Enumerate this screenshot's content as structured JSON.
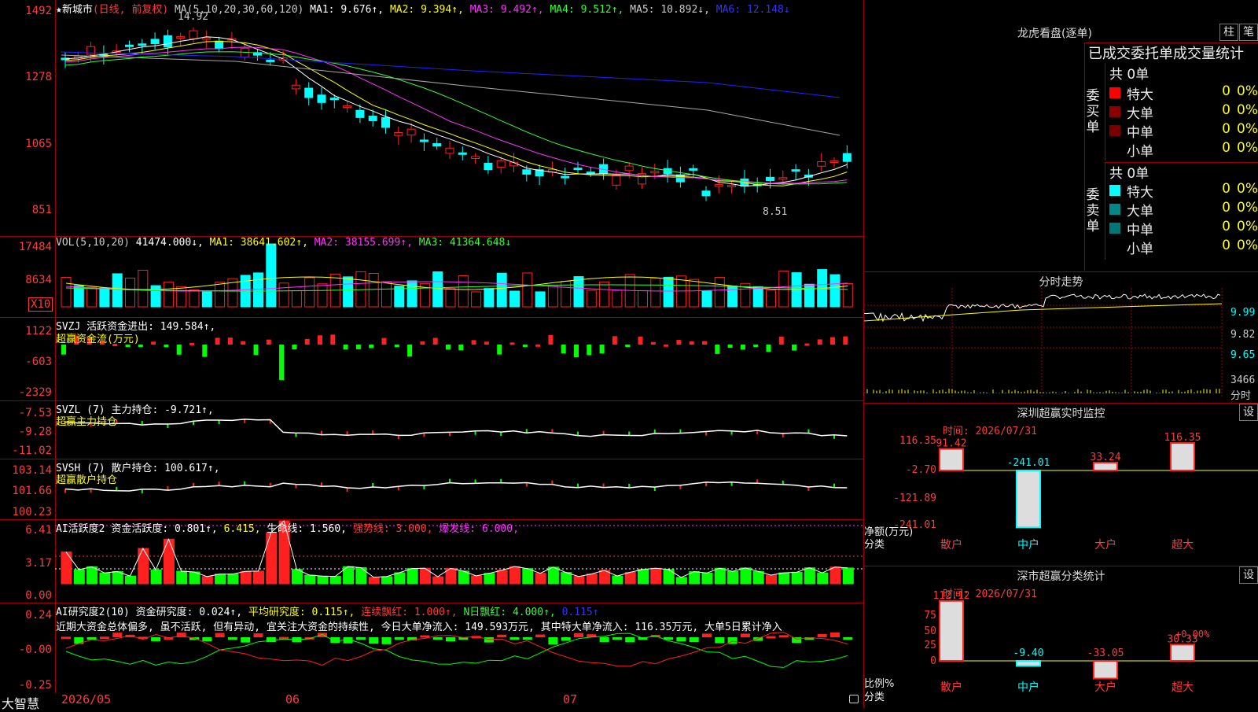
{
  "colors": {
    "up": "#ff2020",
    "down": "#00ffff",
    "grid": "#a00000",
    "axis": "#ff3b3b",
    "ma1": "#ffffff",
    "ma2": "#ffff00",
    "ma3": "#ff33ff",
    "ma4": "#33ff33",
    "ma5": "#aaaaaa",
    "ma6": "#2222ff"
  },
  "kline": {
    "star": "★",
    "stock_name": "新城市",
    "period": "(日线, 前复权)",
    "ma_params": "MA(5,10,20,30,60,120)",
    "ma1": "MA1: 9.676↑,",
    "ma2": "MA2: 9.394↑,",
    "ma3": "MA3: 9.492↑,",
    "ma4": "MA4: 9.512↑,",
    "ma5": "MA5: 10.892↓,",
    "ma6": "MA6: 12.148↓",
    "y_labels": [
      "1492",
      "1278",
      "1065",
      "851"
    ],
    "high_mark": "14.92",
    "low_mark": "8.51"
  },
  "vol": {
    "params": "VOL(5,10,20)",
    "val": "41474.000↓,",
    "ma1": "MA1: 38641.602↑,",
    "ma2": "MA2: 38155.699↑,",
    "ma3": "MA3: 41364.648↓",
    "y_labels": [
      "17484",
      "8634"
    ],
    "unit": "X10"
  },
  "svzj": {
    "header": "SVZJ  活跃资金进出: 149.584↑,",
    "sub": "超赢资金流(万元)",
    "y_labels": [
      "1122",
      "-603",
      "-2329"
    ]
  },
  "svzl": {
    "header": "SVZL (7) 主力持仓: -9.721↑,",
    "sub": "超赢主力持仓",
    "y_labels": [
      "-7.53",
      "-9.28",
      "-11.02"
    ]
  },
  "svsh": {
    "header": "SVSH (7) 散户持仓: 100.617↑,",
    "sub": "超赢散户持仓",
    "y_labels": [
      "103.14",
      "101.66",
      "100.23"
    ]
  },
  "ai1": {
    "name": "AI活跃度2",
    "h1": "资金活跃度: 0.801↑,",
    "h2": "6.415,",
    "h3": "生命线: 1.560,",
    "h4": "强势线: 3.000,",
    "h5": "爆发线: 6.000,",
    "y_labels": [
      "6.41",
      "3.17",
      "0.00"
    ]
  },
  "ai2": {
    "name": "AI研究度2(10)",
    "h1": "资金研究度: 0.024↑,",
    "h2": "平均研究度: 0.115↑,",
    "h3": "连续飘红: 1.000↑,",
    "h4": "N日飘红: 4.000↑,",
    "h5": "0.115↑",
    "note": "近期大资金总体偏多, 虽不活跃, 但有异动, 宜关注大资金的持续性, 今日大单净流入: 149.593万元, 其中特大单净流入: 116.35万元, 大单5日累计净入",
    "y_labels": [
      "0.24",
      "-0.00",
      "-0.25"
    ]
  },
  "xaxis": {
    "brand": "大智慧",
    "labels": [
      "2026/05",
      "06",
      "07"
    ]
  },
  "dragon": {
    "title": "龙虎看盘(逐单)",
    "btn1": "柱",
    "btn2": "笔",
    "subtitle": "已成交委托单成交量统计",
    "buy": {
      "side": "委买单",
      "total": "共 0单",
      "rows": [
        {
          "label": "特大",
          "count": "0",
          "pct": "0%",
          "color": "#ff0000"
        },
        {
          "label": "大单",
          "count": "0",
          "pct": "0%",
          "color": "#8b0000"
        },
        {
          "label": "中单",
          "count": "0",
          "pct": "0%",
          "color": "#7a0000"
        },
        {
          "label": "小单",
          "count": "0",
          "pct": "0%",
          "color": ""
        }
      ]
    },
    "sell": {
      "side": "委卖单",
      "total": "共 0单",
      "rows": [
        {
          "label": "特大",
          "count": "0",
          "pct": "0%",
          "color": "#00ffff"
        },
        {
          "label": "大单",
          "count": "0",
          "pct": "0%",
          "color": "#008888"
        },
        {
          "label": "中单",
          "count": "0",
          "pct": "0%",
          "color": "#007777"
        },
        {
          "label": "小单",
          "count": "0",
          "pct": "0%",
          "color": ""
        }
      ]
    }
  },
  "intraday": {
    "title": "分时走势",
    "y_labels": [
      "9.99",
      "9.82",
      "9.65"
    ],
    "vol_label": "3466",
    "vol_unit": "分时"
  },
  "monitor": {
    "title": "深圳超赢实时监控",
    "btn": "设",
    "time": "时间: 2026/07/31",
    "y_labels": [
      "116.35",
      "-2.70",
      "-121.89",
      "-241.01"
    ],
    "unit": "净额(万元)",
    "cat_label": "分类",
    "bars": [
      {
        "cat": "散户",
        "value": 91.42,
        "label": "91.42"
      },
      {
        "cat": "中户",
        "value": -241.01,
        "label": "-241.01"
      },
      {
        "cat": "大户",
        "value": 33.24,
        "label": "33.24"
      },
      {
        "cat": "超大",
        "value": 116.35,
        "label": "116.35"
      }
    ]
  },
  "classify": {
    "title": "深市超赢分类统计",
    "btn": "设",
    "time": "时间: 2026/07/31",
    "y_labels": [
      "75",
      "50",
      "25",
      "0"
    ],
    "unit": "比例%",
    "cat_label": "分类",
    "bars": [
      {
        "cat": "散户",
        "value": 112.12,
        "label": "112.12"
      },
      {
        "cat": "中户",
        "value": -9.4,
        "label": "-9.40"
      },
      {
        "cat": "大户",
        "value": -33.05,
        "label": "-33.05"
      },
      {
        "cat": "超大",
        "value": 30.33,
        "label": "30.33"
      }
    ],
    "annot": "+0.00%"
  }
}
